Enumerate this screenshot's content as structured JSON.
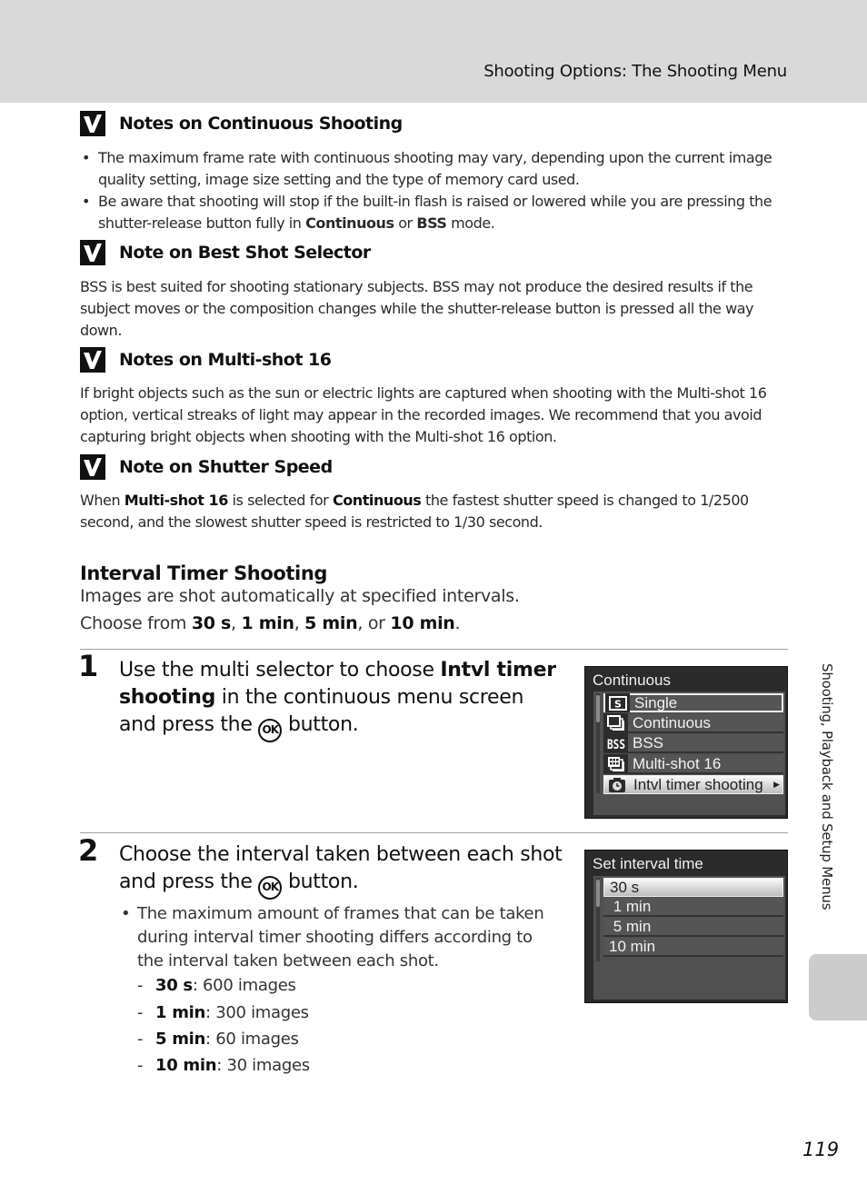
{
  "header": {
    "title": "Shooting Options: The Shooting Menu"
  },
  "notes": [
    {
      "title": "Notes on Continuous Shooting",
      "bullets": [
        {
          "text": "The maximum frame rate with continuous shooting may vary, depending upon the current image quality setting, image size setting and the type of memory card used."
        },
        {
          "pre": "Be aware that shooting will stop if the built-in flash is raised or lowered while you are pressing the shutter-release button fully in ",
          "bold1": "Continuous",
          "mid": " or ",
          "bold2": "BSS",
          "post": " mode."
        }
      ]
    },
    {
      "title": "Note on Best Shot Selector",
      "text": "BSS is best suited for shooting stationary subjects. BSS may not produce the desired results if the subject moves or the composition changes while the shutter-release button is pressed all the way down."
    },
    {
      "title": "Notes on Multi-shot 16",
      "text": "If bright objects such as the sun or electric lights are captured when shooting with the Multi-shot 16 option, vertical streaks of light may appear in the recorded images. We recommend that you avoid capturing bright objects when shooting with the Multi-shot 16 option."
    },
    {
      "title": "Note on Shutter Speed",
      "pre": "When ",
      "bold1": "Multi-shot 16",
      "mid": " is selected for ",
      "bold2": "Continuous",
      "post": " the fastest shutter speed is changed to 1/2500 second, and the slowest shutter speed is restricted to 1/30 second."
    }
  ],
  "section": {
    "title": "Interval Timer Shooting",
    "line1": "Images are shot automatically at specified intervals.",
    "line2_pre": "Choose from ",
    "options": [
      "30 s",
      "1 min",
      "5 min",
      "10 min"
    ],
    "sep1": ", ",
    "sep_or": ", or ",
    "line2_post": "."
  },
  "steps": [
    {
      "number": "1",
      "pre": "Use the multi selector to choose ",
      "bold": "Intvl timer shooting",
      "post": " in the continuous menu screen and press the ",
      "ok": "OK",
      "end": " button."
    },
    {
      "number": "2",
      "pre": "Choose the interval taken between each shot and press the ",
      "ok": "OK",
      "end": " button.",
      "bullet": "The maximum amount of frames that can be taken during interval timer shooting differs according to the interval taken between each shot.",
      "limits": [
        {
          "interval": "30 s",
          "frames": ": 600 images"
        },
        {
          "interval": "1 min",
          "frames": ": 300 images"
        },
        {
          "interval": "5 min",
          "frames": ": 60 images"
        },
        {
          "interval": "10 min",
          "frames": ": 30 images"
        }
      ]
    }
  ],
  "screen1": {
    "title": "Continuous",
    "items": [
      {
        "icon": "single-frame-icon",
        "glyph": "S",
        "label": "Single"
      },
      {
        "icon": "continuous-icon",
        "glyph": "",
        "label": "Continuous"
      },
      {
        "icon": "bss-icon",
        "glyph": "BSS",
        "label": "BSS"
      },
      {
        "icon": "multi-shot-icon",
        "glyph": "",
        "label": "Multi-shot 16"
      },
      {
        "icon": "interval-timer-icon",
        "glyph": "",
        "label": "Intvl timer shooting"
      }
    ],
    "outlined_index": 0,
    "highlighted_index": 4
  },
  "screen2": {
    "title": "Set interval time",
    "items": [
      "30 s",
      " 1 min",
      " 5 min",
      "10 min"
    ],
    "highlighted_index": 0
  },
  "side_tab": {
    "label": "Shooting, Playback and Setup Menus"
  },
  "page_number": "119"
}
